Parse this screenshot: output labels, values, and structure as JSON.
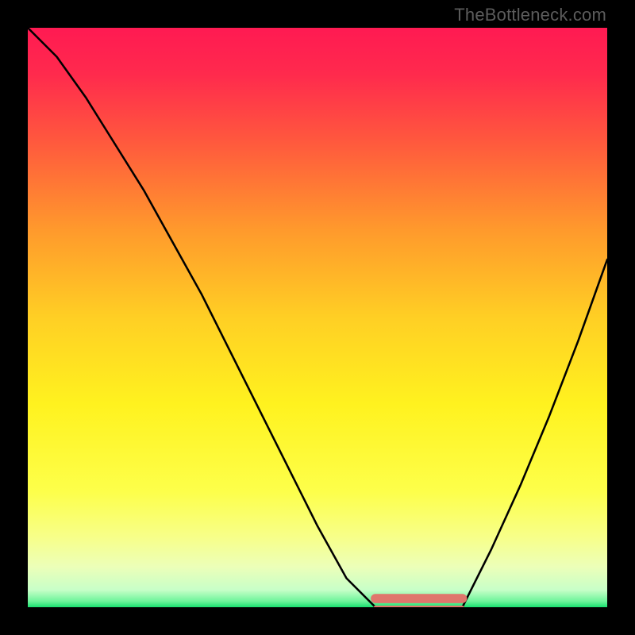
{
  "attribution": "TheBottleneck.com",
  "chart_data": {
    "type": "line",
    "title": "",
    "xlabel": "",
    "ylabel": "",
    "xlim": [
      0,
      100
    ],
    "ylim": [
      0,
      100
    ],
    "grid": false,
    "legend": false,
    "series": [
      {
        "name": "left-descending-curve",
        "color": "#000000",
        "x": [
          0,
          5,
          10,
          15,
          20,
          25,
          30,
          35,
          40,
          45,
          50,
          55,
          60
        ],
        "values": [
          100,
          95,
          88,
          80,
          72,
          63,
          54,
          44,
          34,
          24,
          14,
          5,
          0
        ]
      },
      {
        "name": "valley-flat-segment",
        "color": "#e0766c",
        "x": [
          60,
          62,
          64,
          66,
          68,
          70,
          72,
          74,
          75
        ],
        "values": [
          0,
          0,
          0,
          0,
          0,
          0,
          0,
          0,
          0
        ]
      },
      {
        "name": "right-ascending-curve",
        "color": "#000000",
        "x": [
          75,
          80,
          85,
          90,
          95,
          100
        ],
        "values": [
          0,
          10,
          21,
          33,
          46,
          60
        ]
      },
      {
        "name": "bottleneck-thick-band",
        "color": "#e0766c",
        "note": "thick bar at valley floor, y≈1.5 with 3 thickness",
        "x": [
          60,
          75
        ],
        "values": [
          1.5,
          1.5
        ]
      }
    ],
    "background_gradient_stops": [
      {
        "pos": 0.0,
        "color": "#ff1a52"
      },
      {
        "pos": 0.08,
        "color": "#ff2a4d"
      },
      {
        "pos": 0.2,
        "color": "#ff5a3d"
      },
      {
        "pos": 0.35,
        "color": "#ff9a2c"
      },
      {
        "pos": 0.5,
        "color": "#ffcf24"
      },
      {
        "pos": 0.65,
        "color": "#fff21f"
      },
      {
        "pos": 0.8,
        "color": "#fdff4a"
      },
      {
        "pos": 0.88,
        "color": "#f7ff8a"
      },
      {
        "pos": 0.93,
        "color": "#ecffb8"
      },
      {
        "pos": 0.97,
        "color": "#c8ffc8"
      },
      {
        "pos": 0.99,
        "color": "#6cf49a"
      },
      {
        "pos": 1.0,
        "color": "#18e070"
      }
    ]
  }
}
